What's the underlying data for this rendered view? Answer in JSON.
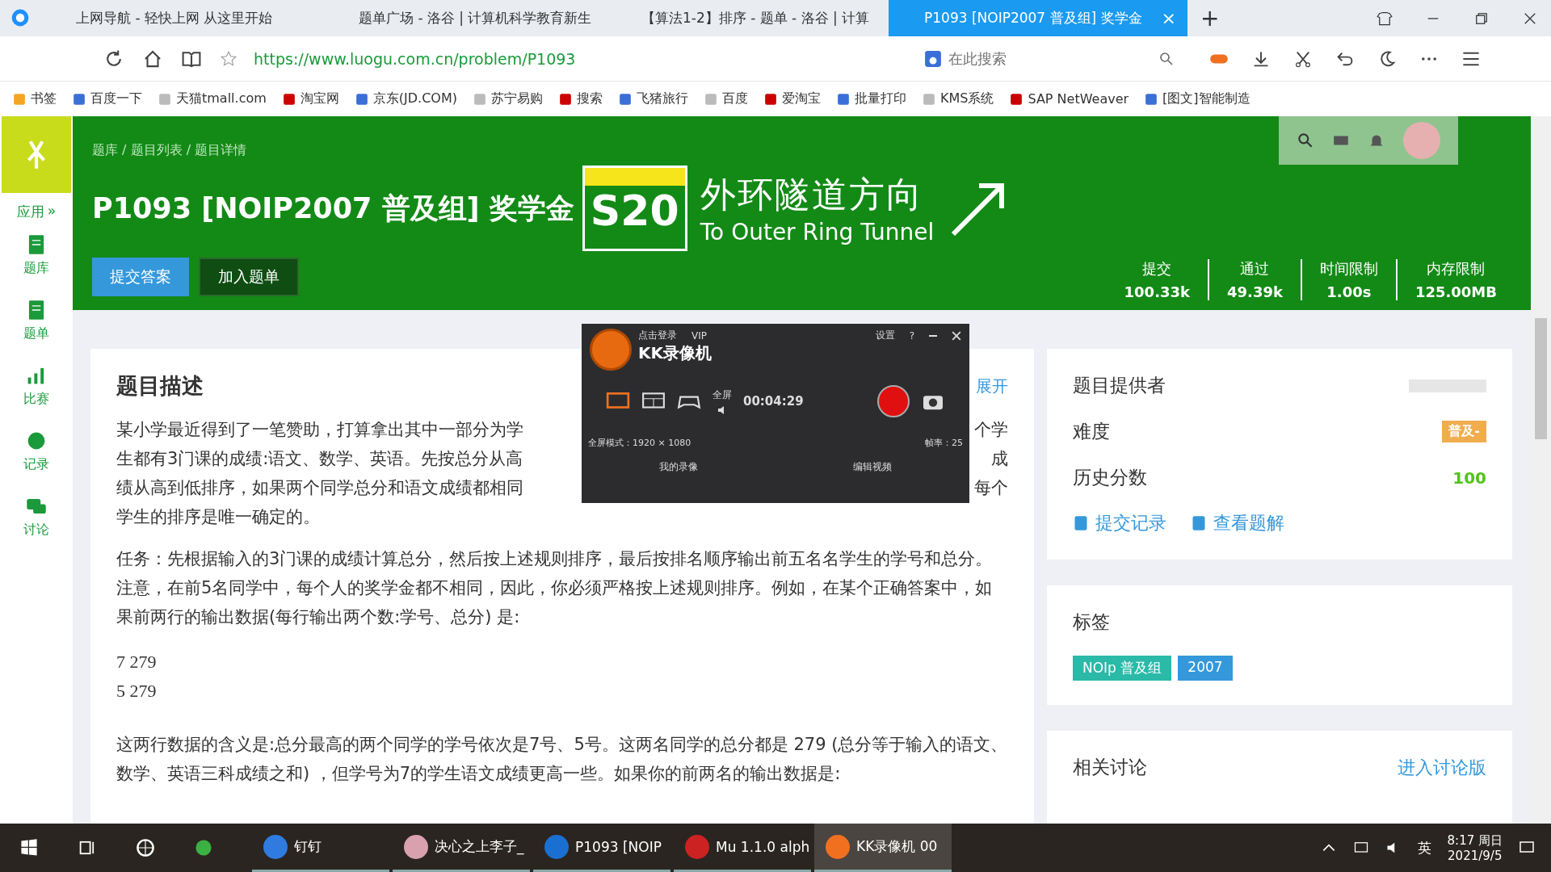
{
  "browser": {
    "tabs": [
      {
        "title": "上网导航 - 轻快上网 从这里开始",
        "selected": false
      },
      {
        "title": "题单广场 - 洛谷 | 计算机科学教育新生",
        "selected": false
      },
      {
        "title": "【算法1-2】排序 - 题单 - 洛谷 | 计算",
        "selected": false
      },
      {
        "title": "P1093 [NOIP2007 普及组] 奖学金",
        "selected": true
      }
    ],
    "new_tab": "+",
    "tab_close": "×",
    "address": "https://www.luogu.com.cn/problem/P1093",
    "search": {
      "placeholder": "在此搜索"
    },
    "bookmarks": [
      "书签",
      "百度一下",
      "天猫tmall.com",
      "淘宝网",
      "京东(JD.COM)",
      "苏宁易购",
      "搜索",
      "飞猪旅行",
      "百度",
      "爱淘宝",
      "批量打印",
      "KMS系统",
      "SAP NetWeaver",
      "[图文]智能制造"
    ]
  },
  "sidebar": {
    "apps_label": "应用",
    "apps_arrow": "»",
    "items": [
      {
        "label": "题库"
      },
      {
        "label": "题单"
      },
      {
        "label": "比赛"
      },
      {
        "label": "记录"
      },
      {
        "label": "讨论"
      }
    ]
  },
  "header": {
    "breadcrumb": "题库 / 题目列表 / 题目详情",
    "title": "P1093 [NOIP2007 普及组] 奖学金",
    "sign": {
      "route": "S20",
      "chinese": "外环隧道方向",
      "english": "To Outer Ring Tunnel"
    },
    "buttons": [
      "提交答案",
      "加入题单"
    ],
    "stats": [
      {
        "label": "提交",
        "value": "100.33k"
      },
      {
        "label": "通过",
        "value": "49.39k"
      },
      {
        "label": "时间限制",
        "value": "1.00s"
      },
      {
        "label": "内存限制",
        "value": "125.00MB"
      }
    ]
  },
  "recorder": {
    "login": "点击登录",
    "vip": "VIP",
    "settings": "设置",
    "help": "?",
    "name": "KK录像机",
    "mode": "全屏",
    "time": "00:04:29",
    "resolution": "全屏模式：1920 × 1080",
    "fps": "帧率：25",
    "links": [
      "我的录像",
      "编辑视频"
    ]
  },
  "problem": {
    "heading": "题目描述",
    "expand": "展开",
    "intro_lines": [
      {
        "left": "某小学最近得到了一笔赞助，打算拿出其中一部分为学",
        "right": "个学"
      },
      {
        "left": "生都有3门课的成绩:语文、数学、英语。先按总分从高",
        "right": "成"
      },
      {
        "left": "绩从高到低排序，如果两个同学总分和语文成绩都相同",
        "right": "每个"
      },
      {
        "left": "学生的排序是唯一确定的。"
      }
    ],
    "task": "任务：先根据输入的3门课的成绩计算总分，然后按上述规则排序，最后按排名顺序输出前五名名学生的学号和总分。注意，在前5名同学中，每个人的奖学金都不相同，因此，你必须严格按上述规则排序。例如，在某个正确答案中，如果前两行的输出数据(每行输出两个数:学号、总分) 是:",
    "sample": [
      "7 279",
      "5 279"
    ],
    "explain": "这两行数据的含义是:总分最高的两个同学的学号依次是7号、5号。这两名同学的总分都是 279 (总分等于输入的语文、数学、英语三科成绩之和) ，但学号为7的学生语文成绩更高一些。如果你的前两名的输出数据是:"
  },
  "info": {
    "provider_label": "题目提供者",
    "difficulty_label": "难度",
    "difficulty": "普及-",
    "score_label": "历史分数",
    "score": "100",
    "links": [
      "提交记录",
      "查看题解"
    ],
    "tags_label": "标签",
    "tags": [
      {
        "label": "NOIp 普及组",
        "color": "#2bb9a8"
      },
      {
        "label": "2007",
        "color": "#3498db"
      }
    ],
    "discuss_label": "相关讨论",
    "discuss_link": "进入讨论版"
  },
  "taskbar": {
    "apps": [
      {
        "label": "钉钉",
        "selected": false
      },
      {
        "label": "决心之上李子_",
        "selected": false
      },
      {
        "label": "P1093 [NOIP",
        "selected": false
      },
      {
        "label": "Mu 1.1.0 alph",
        "selected": false
      },
      {
        "label": "KK录像机 00",
        "selected": true
      }
    ],
    "ime": "英",
    "time": "8:17 周日",
    "date": "2021/9/5"
  }
}
